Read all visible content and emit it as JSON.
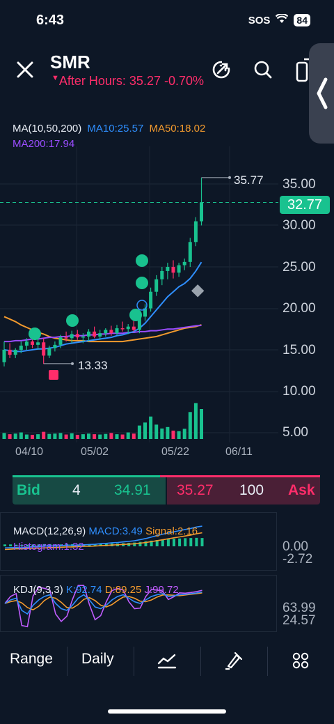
{
  "status_bar": {
    "time": "6:43",
    "sos": "SOS",
    "battery": "84"
  },
  "header": {
    "symbol": "SMR",
    "after_hours": "After Hours: 35.27 -0.70%"
  },
  "ma_legend": {
    "params": "MA(10,50,200)",
    "ma10": "MA10:25.57",
    "ma50": "MA50:18.02",
    "ma200": "MA200:17.94"
  },
  "colors": {
    "background": "#0d1726",
    "up": "#19c28f",
    "down": "#ff2d6a",
    "ma10": "#2f8fff",
    "ma50": "#f29a2e",
    "ma200": "#9a4dff"
  },
  "chart_data": {
    "type": "candlestick",
    "price_ticks": [
      "35.00",
      "30.00",
      "25.00",
      "20.00",
      "15.00",
      "10.00",
      "5.00"
    ],
    "date_ticks": [
      "04/10",
      "05/02",
      "05/22",
      "06/11"
    ],
    "high_label": "35.77",
    "low_label": "13.33",
    "current_price": "32.77",
    "candles": [
      [
        13.5,
        16.0,
        13.0,
        15.0
      ],
      [
        15.0,
        15.8,
        14.0,
        14.4
      ],
      [
        14.4,
        15.2,
        14.0,
        15.0
      ],
      [
        15.0,
        16.0,
        14.6,
        15.5
      ],
      [
        15.5,
        16.4,
        15.0,
        16.0
      ],
      [
        16.0,
        16.6,
        15.2,
        15.6
      ],
      [
        15.6,
        16.3,
        15.0,
        15.9
      ],
      [
        15.9,
        16.4,
        13.3,
        14.3
      ],
      [
        14.3,
        15.5,
        14.0,
        15.2
      ],
      [
        15.2,
        16.0,
        14.8,
        15.6
      ],
      [
        15.6,
        16.8,
        15.2,
        16.5
      ],
      [
        16.5,
        17.2,
        16.0,
        16.4
      ],
      [
        16.4,
        17.3,
        15.8,
        16.9
      ],
      [
        16.9,
        17.4,
        16.2,
        16.5
      ],
      [
        16.5,
        17.0,
        15.8,
        16.6
      ],
      [
        16.6,
        17.5,
        16.0,
        17.2
      ],
      [
        17.2,
        17.8,
        16.4,
        16.6
      ],
      [
        16.6,
        17.4,
        16.2,
        17.0
      ],
      [
        17.0,
        17.6,
        16.6,
        17.4
      ],
      [
        17.4,
        17.9,
        16.7,
        17.0
      ],
      [
        17.0,
        18.0,
        16.8,
        17.6
      ],
      [
        17.6,
        18.4,
        17.2,
        17.5
      ],
      [
        17.5,
        18.1,
        16.9,
        17.8
      ],
      [
        17.8,
        18.6,
        17.2,
        17.4
      ],
      [
        17.4,
        19.5,
        17.0,
        19.0
      ],
      [
        19.0,
        20.5,
        18.5,
        20.0
      ],
      [
        20.0,
        22.5,
        19.6,
        22.0
      ],
      [
        22.0,
        24.0,
        21.5,
        23.5
      ],
      [
        23.5,
        25.0,
        22.8,
        24.5
      ],
      [
        24.5,
        25.5,
        23.5,
        25.0
      ],
      [
        25.0,
        25.8,
        23.6,
        24.3
      ],
      [
        24.3,
        25.5,
        23.8,
        25.2
      ],
      [
        25.2,
        26.0,
        24.6,
        25.6
      ],
      [
        25.6,
        28.5,
        25.0,
        28.0
      ],
      [
        28.0,
        31.0,
        27.5,
        30.5
      ],
      [
        30.5,
        35.77,
        30.0,
        32.77
      ]
    ],
    "volume": [
      [
        2,
        "up"
      ],
      [
        1.6,
        "down"
      ],
      [
        1.8,
        "up"
      ],
      [
        2.2,
        "up"
      ],
      [
        1.5,
        "up"
      ],
      [
        1.4,
        "down"
      ],
      [
        1.6,
        "up"
      ],
      [
        2.4,
        "down"
      ],
      [
        1.7,
        "up"
      ],
      [
        1.8,
        "up"
      ],
      [
        2.0,
        "up"
      ],
      [
        1.5,
        "down"
      ],
      [
        1.9,
        "up"
      ],
      [
        1.4,
        "down"
      ],
      [
        1.6,
        "up"
      ],
      [
        1.8,
        "up"
      ],
      [
        1.6,
        "down"
      ],
      [
        1.5,
        "up"
      ],
      [
        1.7,
        "up"
      ],
      [
        2.0,
        "down"
      ],
      [
        1.6,
        "up"
      ],
      [
        1.5,
        "down"
      ],
      [
        2.2,
        "up"
      ],
      [
        1.8,
        "down"
      ],
      [
        4.5,
        "up"
      ],
      [
        5.5,
        "up"
      ],
      [
        7.5,
        "up"
      ],
      [
        4.8,
        "up"
      ],
      [
        3.5,
        "up"
      ],
      [
        4.0,
        "up"
      ],
      [
        2.8,
        "down"
      ],
      [
        2.6,
        "up"
      ],
      [
        3.4,
        "up"
      ],
      [
        9.0,
        "up"
      ],
      [
        12.0,
        "up"
      ],
      [
        10.0,
        "up"
      ]
    ],
    "ma10": [
      15.0,
      14.9,
      14.8,
      14.8,
      14.9,
      15.0,
      15.1,
      15.1,
      15.2,
      15.3,
      15.5,
      15.7,
      15.8,
      15.9,
      16.0,
      16.1,
      16.2,
      16.3,
      16.4,
      16.5,
      16.7,
      16.8,
      17.0,
      17.2,
      17.6,
      18.2,
      19.0,
      19.8,
      20.6,
      21.4,
      22.0,
      22.6,
      23.0,
      23.6,
      24.5,
      25.57
    ],
    "ma50": [
      19.0,
      18.7,
      18.4,
      18.0,
      17.7,
      17.4,
      17.1,
      16.9,
      16.6,
      16.4,
      16.3,
      16.2,
      16.1,
      16.1,
      16.1,
      16.0,
      16.0,
      16.0,
      16.0,
      16.0,
      16.0,
      16.0,
      16.1,
      16.2,
      16.3,
      16.4,
      16.5,
      16.6,
      16.8,
      17.0,
      17.2,
      17.4,
      17.6,
      17.7,
      17.8,
      18.02
    ],
    "ma200": [
      16.0,
      16.0,
      16.1,
      16.1,
      16.2,
      16.3,
      16.3,
      16.4,
      16.5,
      16.5,
      16.6,
      16.6,
      16.7,
      16.7,
      16.7,
      16.8,
      16.8,
      16.9,
      16.9,
      17.0,
      17.0,
      17.0,
      17.1,
      17.1,
      17.2,
      17.2,
      17.3,
      17.3,
      17.4,
      17.5,
      17.5,
      17.6,
      17.7,
      17.8,
      17.9,
      17.94
    ]
  },
  "bid_ask": {
    "bid_label": "Bid",
    "bid_size": "4",
    "bid_price": "34.91",
    "ask_price": "35.27",
    "ask_size": "100",
    "ask_label": "Ask"
  },
  "macd": {
    "params": "MACD(12,26,9)",
    "macd": "MACD:3.49",
    "signal": "Signal:2.16",
    "histogram": "Histogram:1.32",
    "axis_top": "0.00",
    "axis_bottom": "-2.72"
  },
  "kdj": {
    "params": "KDJ(9,3,3)",
    "k": "K:92.74",
    "d": "D:89.25",
    "j": "J:99.72",
    "axis_top": "63.99",
    "axis_bottom": "24.57"
  },
  "bottom_nav": {
    "range": "Range",
    "daily": "Daily"
  }
}
